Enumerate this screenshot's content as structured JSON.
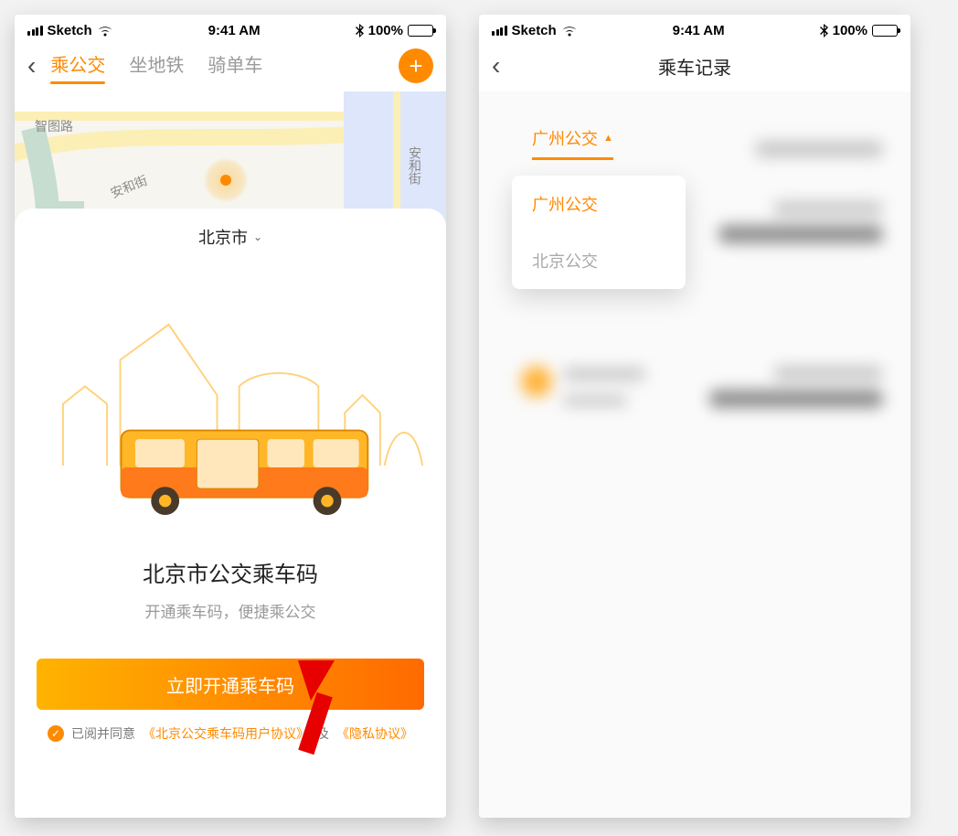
{
  "status_bar": {
    "carrier": "Sketch",
    "time": "9:41 AM",
    "battery_text": "100%"
  },
  "phone1": {
    "tabs": {
      "bus": "乘公交",
      "subway": "坐地铁",
      "bike": "骑单车"
    },
    "map_labels": {
      "zhitu": "智图路",
      "anhe1": "安和街",
      "anhe2": "安和街"
    },
    "city": "北京市",
    "title": "北京市公交乘车码",
    "subtitle": "开通乘车码，便捷乘公交",
    "cta": "立即开通乘车码",
    "agreement_prefix": "已阅并同意",
    "agreement_link1": "《北京公交乘车码用户协议》",
    "agreement_and": "及",
    "agreement_link2": "《隐私协议》"
  },
  "phone2": {
    "title": "乘车记录",
    "filter_selected": "广州公交",
    "dropdown": [
      "广州公交",
      "北京公交"
    ]
  }
}
